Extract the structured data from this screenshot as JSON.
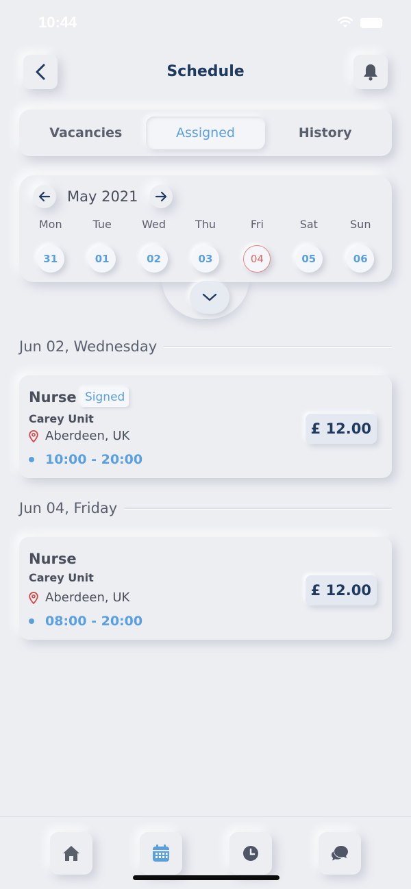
{
  "status": {
    "time": "10:44"
  },
  "header": {
    "title": "Schedule"
  },
  "tabs": [
    {
      "label": "Vacancies",
      "active": false
    },
    {
      "label": "Assigned",
      "active": true
    },
    {
      "label": "History",
      "active": false
    }
  ],
  "calendar": {
    "month": "May 2021",
    "days": [
      {
        "name": "Mon",
        "num": "31"
      },
      {
        "name": "Tue",
        "num": "01"
      },
      {
        "name": "Wed",
        "num": "02"
      },
      {
        "name": "Thu",
        "num": "03"
      },
      {
        "name": "Fri",
        "num": "04"
      },
      {
        "name": "Sat",
        "num": "05"
      },
      {
        "name": "Sun",
        "num": "06"
      }
    ],
    "selected_index": 4
  },
  "sections": [
    {
      "title": "Jun 02, Wednesday",
      "card": {
        "job": "Nurse",
        "badge": "Signed",
        "unit": "Carey Unit",
        "location": "Aberdeen, UK",
        "time": "10:00 - 20:00",
        "price": "£ 12.00"
      }
    },
    {
      "title": "Jun 04, Friday",
      "card": {
        "job": "Nurse",
        "unit": "Carey Unit",
        "location": "Aberdeen, UK",
        "time": "08:00 - 20:00",
        "price": "£ 12.00"
      }
    }
  ],
  "nav": [
    {
      "icon": "home-icon",
      "active": false
    },
    {
      "icon": "calendar-icon",
      "active": true
    },
    {
      "icon": "clock-icon",
      "active": false
    },
    {
      "icon": "chat-icon",
      "active": false
    }
  ],
  "colors": {
    "accent": "#5a9fe0",
    "title": "#1f3a5f",
    "today": "#e26464",
    "background": "#eceef2"
  }
}
